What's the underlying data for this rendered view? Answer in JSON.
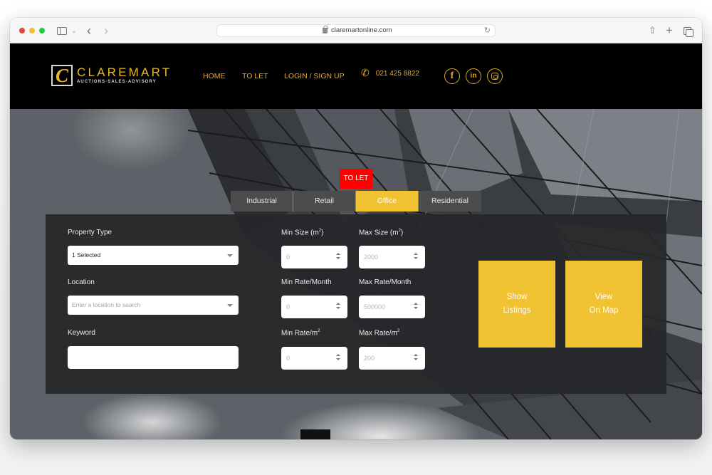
{
  "browser": {
    "url": "claremartonline.com",
    "traffic_lights": [
      "close",
      "minimize",
      "zoom"
    ],
    "icons": [
      "sidebar-icon",
      "chevron-down-icon",
      "back-icon",
      "forward-icon",
      "lock-icon",
      "reload-icon",
      "share-icon",
      "new-tab-icon",
      "tab-overview-icon"
    ]
  },
  "header": {
    "logo": {
      "mark": "C",
      "name": "CLAREMART",
      "tagline": "AUCTIONS·SALES·ADVISORY"
    },
    "nav": [
      {
        "label": "HOME"
      },
      {
        "label": "TO LET"
      },
      {
        "label": "LOGIN / SIGN UP"
      }
    ],
    "phone": {
      "icon": "phone-icon",
      "number": "021 425 8822"
    },
    "social": [
      {
        "name": "facebook-icon",
        "glyph": "f"
      },
      {
        "name": "linkedin-icon",
        "glyph": "in"
      },
      {
        "name": "instagram-icon",
        "glyph": ""
      }
    ],
    "accent_color": "#e3aa2a"
  },
  "search": {
    "badge": "TO LET",
    "badge_color": "#ff0000",
    "tabs": [
      {
        "label": "Industrial",
        "active": false
      },
      {
        "label": "Retail",
        "active": false
      },
      {
        "label": "Office",
        "active": true
      },
      {
        "label": "Residential",
        "active": false
      }
    ],
    "active_color": "#f1c232",
    "property_type": {
      "label": "Property Type",
      "value": "1 Selected"
    },
    "location": {
      "label": "Location",
      "placeholder": "Enter a location to search"
    },
    "keyword": {
      "label": "Keyword",
      "value": ""
    },
    "min_size": {
      "label": "Min Size (m",
      "sup": "2",
      "suffix": ")",
      "placeholder": "0"
    },
    "max_size": {
      "label": "Max Size (m",
      "sup": "2",
      "suffix": ")",
      "placeholder": "2000"
    },
    "min_rate_month": {
      "label": "Min Rate/Month",
      "placeholder": "0"
    },
    "max_rate_month": {
      "label": "Max Rate/Month",
      "placeholder": "500000"
    },
    "min_rate_m2": {
      "label": "Min Rate/m",
      "sup": "2",
      "placeholder": "0"
    },
    "max_rate_m2": {
      "label": "Max Rate/m",
      "sup": "2",
      "placeholder": "200"
    },
    "buttons": {
      "show_listings": [
        "Show",
        "Listings"
      ],
      "view_on_map": [
        "View",
        "On Map"
      ]
    }
  }
}
